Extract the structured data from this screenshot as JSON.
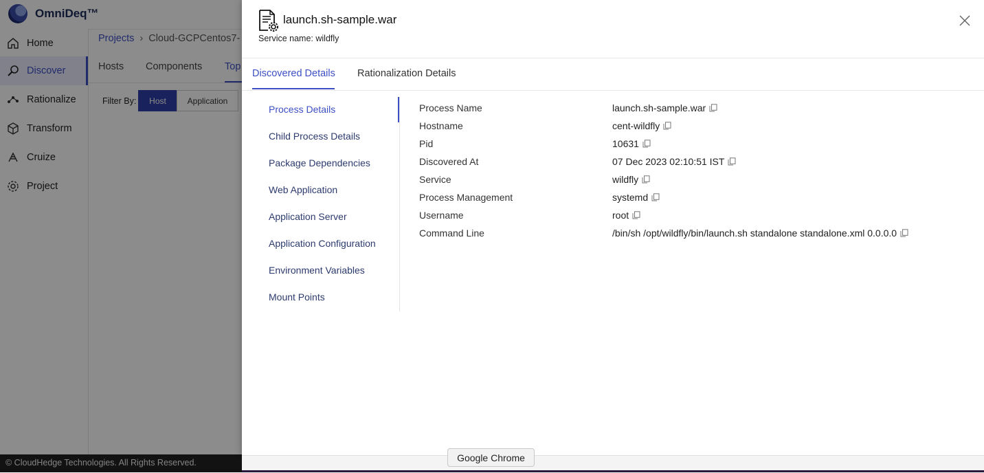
{
  "app": {
    "brand": "OmniDeq™"
  },
  "sidebar": {
    "items": [
      {
        "label": "Home",
        "icon": "home-icon"
      },
      {
        "label": "Discover",
        "icon": "discover-icon"
      },
      {
        "label": "Rationalize",
        "icon": "rationalize-icon"
      },
      {
        "label": "Transform",
        "icon": "transform-icon"
      },
      {
        "label": "Cruize",
        "icon": "cruize-icon"
      },
      {
        "label": "Project",
        "icon": "project-gear-icon"
      }
    ]
  },
  "breadcrumb": {
    "root": "Projects",
    "current": "Cloud-GCPCentos7-"
  },
  "background_tabs": [
    "Hosts",
    "Components",
    "Top"
  ],
  "filter": {
    "label": "Filter By:",
    "options": [
      "Host",
      "Application"
    ],
    "selected": "Host"
  },
  "footer": {
    "copyright": "© CloudHedge Technologies. All Rights Reserved."
  },
  "drawer": {
    "title": "launch.sh-sample.war",
    "subtitle": "Service name: wildfly",
    "tabs": [
      "Discovered Details",
      "Rationalization Details"
    ],
    "active_tab": "Discovered Details",
    "subnav": [
      "Process Details",
      "Child Process Details",
      "Package Dependencies",
      "Web Application",
      "Application Server",
      "Application Configuration",
      "Environment Variables",
      "Mount Points"
    ],
    "active_subnav": "Process Details",
    "details": [
      {
        "label": "Process Name",
        "value": "launch.sh-sample.war"
      },
      {
        "label": "Hostname",
        "value": "cent-wildfly"
      },
      {
        "label": "Pid",
        "value": "10631"
      },
      {
        "label": "Discovered At",
        "value": "07 Dec 2023 02:10:51 IST"
      },
      {
        "label": "Service",
        "value": "wildfly"
      },
      {
        "label": "Process Management",
        "value": "systemd"
      },
      {
        "label": "Username",
        "value": "root"
      },
      {
        "label": "Command Line",
        "value": "/bin/sh /opt/wildfly/bin/launch.sh standalone standalone.xml 0.0.0.0"
      }
    ]
  },
  "tooltip": {
    "text": "Google Chrome"
  },
  "colors": {
    "accent": "#3d4fc4",
    "primary_button": "#2f3fa8",
    "footer": "#222222"
  }
}
